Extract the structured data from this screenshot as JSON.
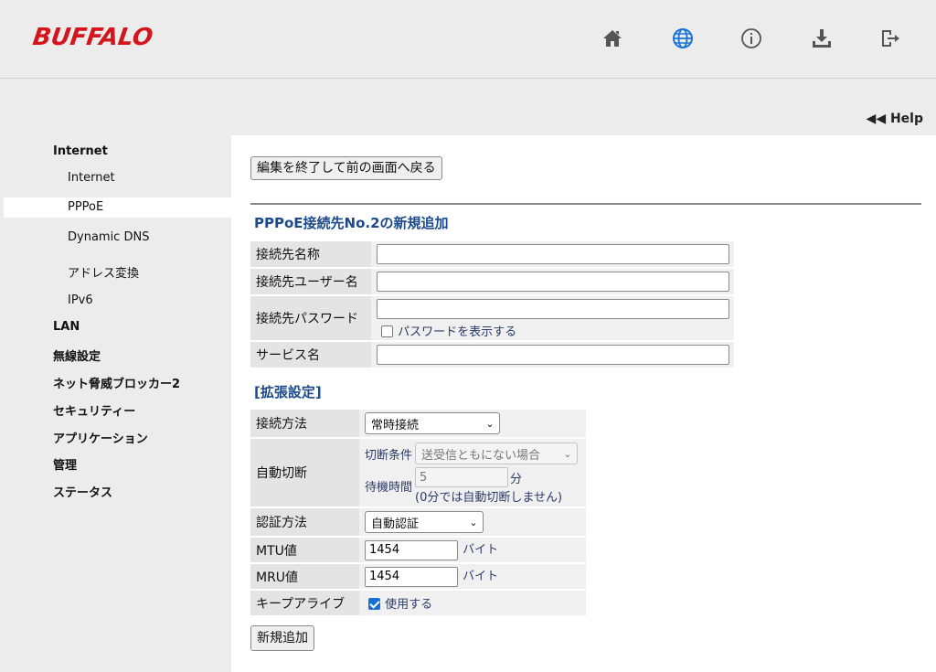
{
  "brand": {
    "logo_text": "BUFFALO",
    "logo_color": "#d4161c"
  },
  "header_icons": [
    "home-icon",
    "globe-icon",
    "info-icon",
    "download-icon",
    "logout-icon"
  ],
  "help": {
    "label": "◀◀ Help"
  },
  "sidebar": {
    "internet": "Internet",
    "internet_sub": "Internet",
    "pppoe": "PPPoE",
    "dynamic_dns": "Dynamic DNS",
    "address_conversion": "アドレス変換",
    "ipv6": "IPv6",
    "lan": "LAN",
    "wireless": "無線設定",
    "threat_blocker": "ネット脅威ブロッカー2",
    "security": "セキュリティー",
    "application": "アプリケーション",
    "management": "管理",
    "status": "ステータス"
  },
  "main": {
    "back_button": "編集を終了して前の画面へ戻る",
    "section_title": "PPPoE接続先No.2の新規追加",
    "basic": {
      "conn_name_label": "接続先名称",
      "conn_name_value": "",
      "user_label": "接続先ユーザー名",
      "user_value": "",
      "password_label": "接続先パスワード",
      "password_value": "",
      "show_password_label": "パスワードを表示する",
      "show_password_checked": false,
      "service_label": "サービス名",
      "service_value": ""
    },
    "extended_title": "[拡張設定]",
    "extended": {
      "conn_method_label": "接続方法",
      "conn_method_value": "常時接続",
      "auto_disconnect_label": "自動切断",
      "cut_condition_label": "切断条件",
      "cut_condition_value": "送受信ともにない場合",
      "wait_time_label": "待機時間",
      "wait_time_value": "5",
      "wait_time_unit": "分",
      "wait_time_note": "(0分では自動切断しません)",
      "auth_label": "認証方法",
      "auth_value": "自動認証",
      "mtu_label": "MTU値",
      "mtu_value": "1454",
      "mtu_unit": "バイト",
      "mru_label": "MRU値",
      "mru_value": "1454",
      "mru_unit": "バイト",
      "keepalive_label": "キープアライブ",
      "keepalive_option": "使用する",
      "keepalive_checked": true
    },
    "add_button": "新規追加"
  }
}
